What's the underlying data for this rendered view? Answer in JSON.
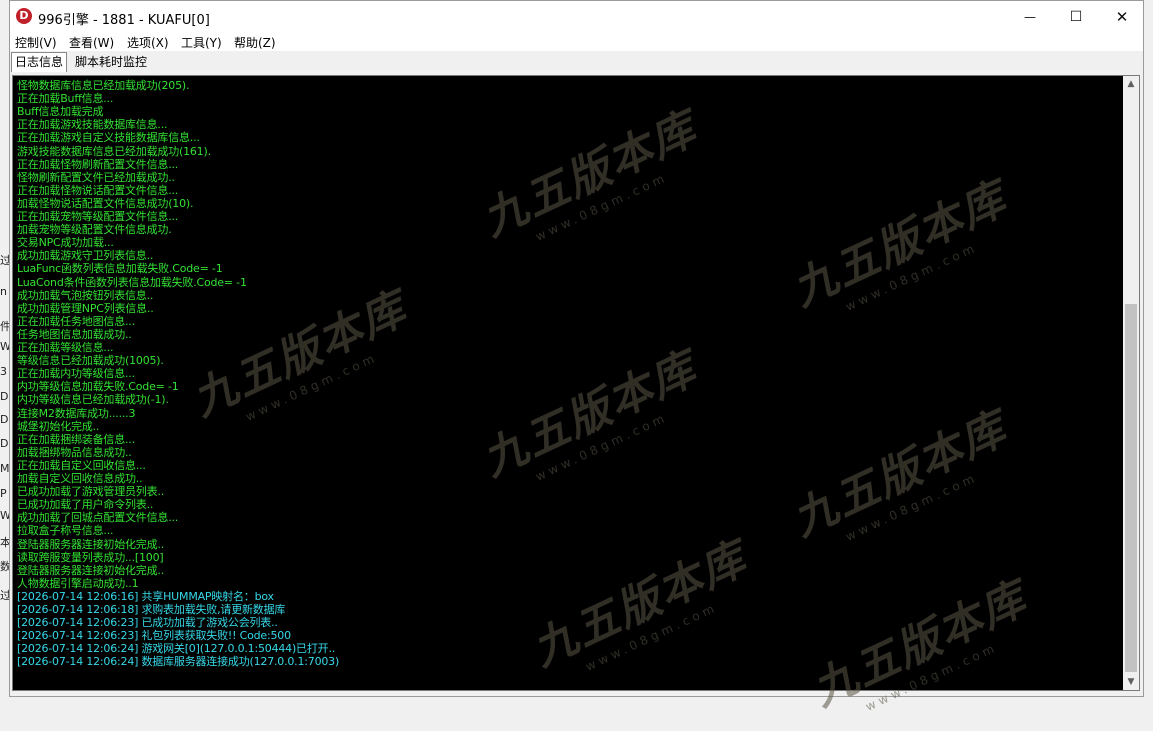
{
  "window": {
    "title": "996引擎 - 1881 - KUAFU[0]",
    "app_icon_letter": "D",
    "minimize_glyph": "—",
    "maximize_glyph": "☐",
    "close_glyph": "✕"
  },
  "menu": [
    "控制(V)",
    "查看(W)",
    "选项(X)",
    "工具(Y)",
    "帮助(Z)"
  ],
  "tabs": [
    "日志信息",
    "脚本耗时监控"
  ],
  "watermark": {
    "main": "九五版本库",
    "sub": "www.08gm.com"
  },
  "background_window_chars": [
    "过",
    "n",
    "件",
    "W",
    "3",
    "D",
    "D",
    "D",
    "M",
    "P",
    "W",
    "本",
    "数",
    "过"
  ],
  "log": [
    {
      "text": "怪物数据库信息已经加载成功(205).",
      "kind": "plain"
    },
    {
      "text": "正在加载Buff信息...",
      "kind": "plain"
    },
    {
      "text": "Buff信息加载完成",
      "kind": "plain"
    },
    {
      "text": "正在加载游戏技能数据库信息...",
      "kind": "plain"
    },
    {
      "text": "正在加载游戏自定义技能数据库信息...",
      "kind": "plain"
    },
    {
      "text": "游戏技能数据库信息已经加载成功(161).",
      "kind": "plain"
    },
    {
      "text": "正在加载怪物刷新配置文件信息...",
      "kind": "plain"
    },
    {
      "text": "怪物刷新配置文件已经加载成功..",
      "kind": "plain"
    },
    {
      "text": "正在加载怪物说话配置文件信息...",
      "kind": "plain"
    },
    {
      "text": "加载怪物说话配置文件信息成功(10).",
      "kind": "plain"
    },
    {
      "text": "正在加载宠物等级配置文件信息...",
      "kind": "plain"
    },
    {
      "text": "加载宠物等级配置文件信息成功.",
      "kind": "plain"
    },
    {
      "text": "交易NPC成功加载...",
      "kind": "plain"
    },
    {
      "text": "成功加载游戏守卫列表信息..",
      "kind": "plain"
    },
    {
      "text": "LuaFunc函数列表信息加载失败.Code= -1",
      "kind": "plain"
    },
    {
      "text": "LuaCond条件函数列表信息加载失败.Code= -1",
      "kind": "plain"
    },
    {
      "text": "成功加载气泡按钮列表信息..",
      "kind": "plain"
    },
    {
      "text": "成功加载管理NPC列表信息..",
      "kind": "plain"
    },
    {
      "text": "正在加载任务地图信息...",
      "kind": "plain"
    },
    {
      "text": "任务地图信息加载成功..",
      "kind": "plain"
    },
    {
      "text": "正在加载等级信息...",
      "kind": "plain"
    },
    {
      "text": "等级信息已经加载成功(1005).",
      "kind": "plain"
    },
    {
      "text": "正在加载内功等级信息...",
      "kind": "plain"
    },
    {
      "text": "内功等级信息加载失败.Code= -1",
      "kind": "plain"
    },
    {
      "text": "内功等级信息已经加载成功(-1).",
      "kind": "plain"
    },
    {
      "text": "连接M2数据库成功......3",
      "kind": "plain"
    },
    {
      "text": "城堡初始化完成..",
      "kind": "plain"
    },
    {
      "text": "正在加载捆绑装备信息...",
      "kind": "plain"
    },
    {
      "text": "加载捆绑物品信息成功..",
      "kind": "plain"
    },
    {
      "text": "正在加载自定义回收信息...",
      "kind": "plain"
    },
    {
      "text": "加载自定义回收信息成功..",
      "kind": "plain"
    },
    {
      "text": "已成功加载了游戏管理员列表..",
      "kind": "plain"
    },
    {
      "text": "已成功加载了用户命令列表..",
      "kind": "plain"
    },
    {
      "text": "成功加载了回城点配置文件信息...",
      "kind": "plain"
    },
    {
      "text": "拉取盒子称号信息...",
      "kind": "plain"
    },
    {
      "text": "登陆器服务器连接初始化完成..",
      "kind": "plain"
    },
    {
      "text": "读取跨服变量列表成功...[100]",
      "kind": "plain"
    },
    {
      "text": "登陆器服务器连接初始化完成..",
      "kind": "plain"
    },
    {
      "text": "人物数据引擎启动成功..1",
      "kind": "plain"
    },
    {
      "text": "[2026-07-14 12:06:16] 共享HUMMAP映射名：box",
      "kind": "ts"
    },
    {
      "text": "[2026-07-14 12:06:18] 求购表加载失败,请更新数据库",
      "kind": "ts"
    },
    {
      "text": "[2026-07-14 12:06:23] 已成功加载了游戏公会列表..",
      "kind": "ts"
    },
    {
      "text": "[2026-07-14 12:06:23] 礼包列表获取失败!! Code:500",
      "kind": "ts"
    },
    {
      "text": "[2026-07-14 12:06:24] 游戏网关[0](127.0.0.1:50444)已打开..",
      "kind": "ts"
    },
    {
      "text": "[2026-07-14 12:06:24] 数据库服务器连接成功(127.0.0.1:7003)",
      "kind": "ts"
    }
  ]
}
